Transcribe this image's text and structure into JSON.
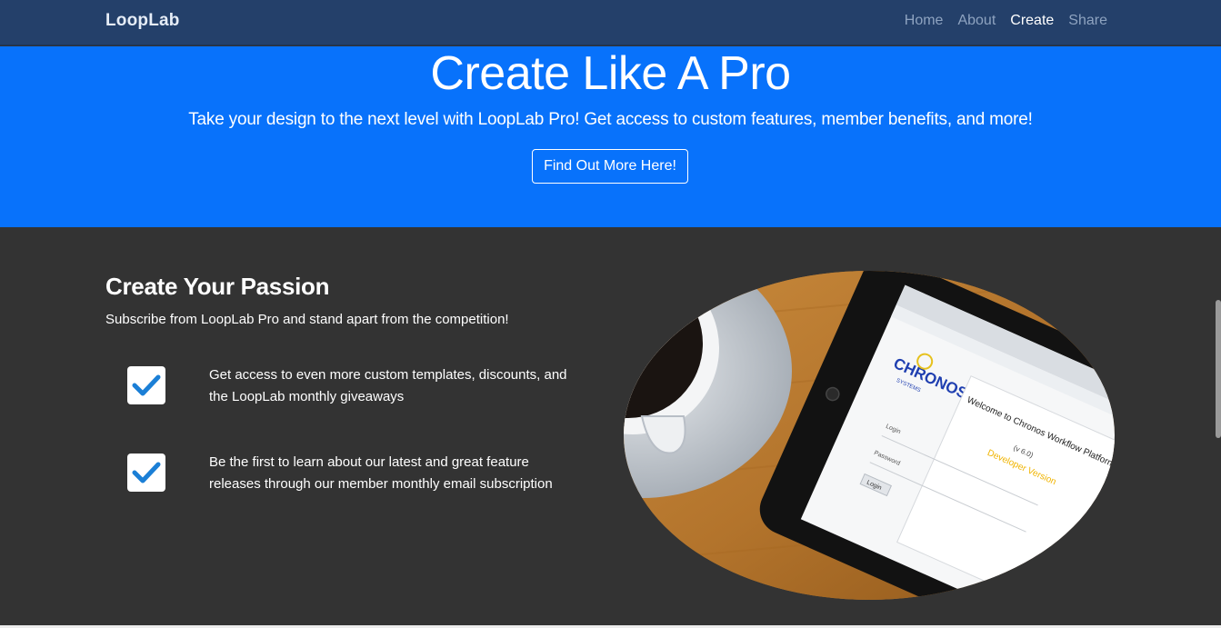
{
  "navbar": {
    "brand": "LoopLab",
    "links": [
      {
        "label": "Home",
        "active": false
      },
      {
        "label": "About",
        "active": false
      },
      {
        "label": "Create",
        "active": true
      },
      {
        "label": "Share",
        "active": false
      }
    ]
  },
  "hero": {
    "title": "Create Like A Pro",
    "subtitle": "Take your design to the next level with LoopLab Pro! Get access to custom features, member benefits, and more!",
    "cta_label": "Find Out More Here!"
  },
  "passion": {
    "title": "Create Your Passion",
    "subtitle": "Subscribe from LoopLab Pro and stand apart from the competition!",
    "features": [
      {
        "text": "Get access to even more custom templates, discounts, and the LoopLab monthly giveaways",
        "icon": "checkbox-checked-icon"
      },
      {
        "text": "Be the first to learn about our latest and great feature releases through our member monthly email subscription",
        "icon": "checkbox-checked-icon"
      }
    ]
  },
  "photo": {
    "tablet_screen": {
      "brand": "CHRONOS",
      "brand_sub": "SYSTEMS",
      "welcome": "Welcome to Chronos Workflow Platform!",
      "version": "(v 6.0)",
      "edition": "Developer Version",
      "login_label": "Login",
      "password_label": "Password",
      "login_button": "Login"
    }
  },
  "colors": {
    "navbar": "#24406a",
    "hero": "#0872fb",
    "section": "#333333",
    "check": "#1b7fd6"
  }
}
